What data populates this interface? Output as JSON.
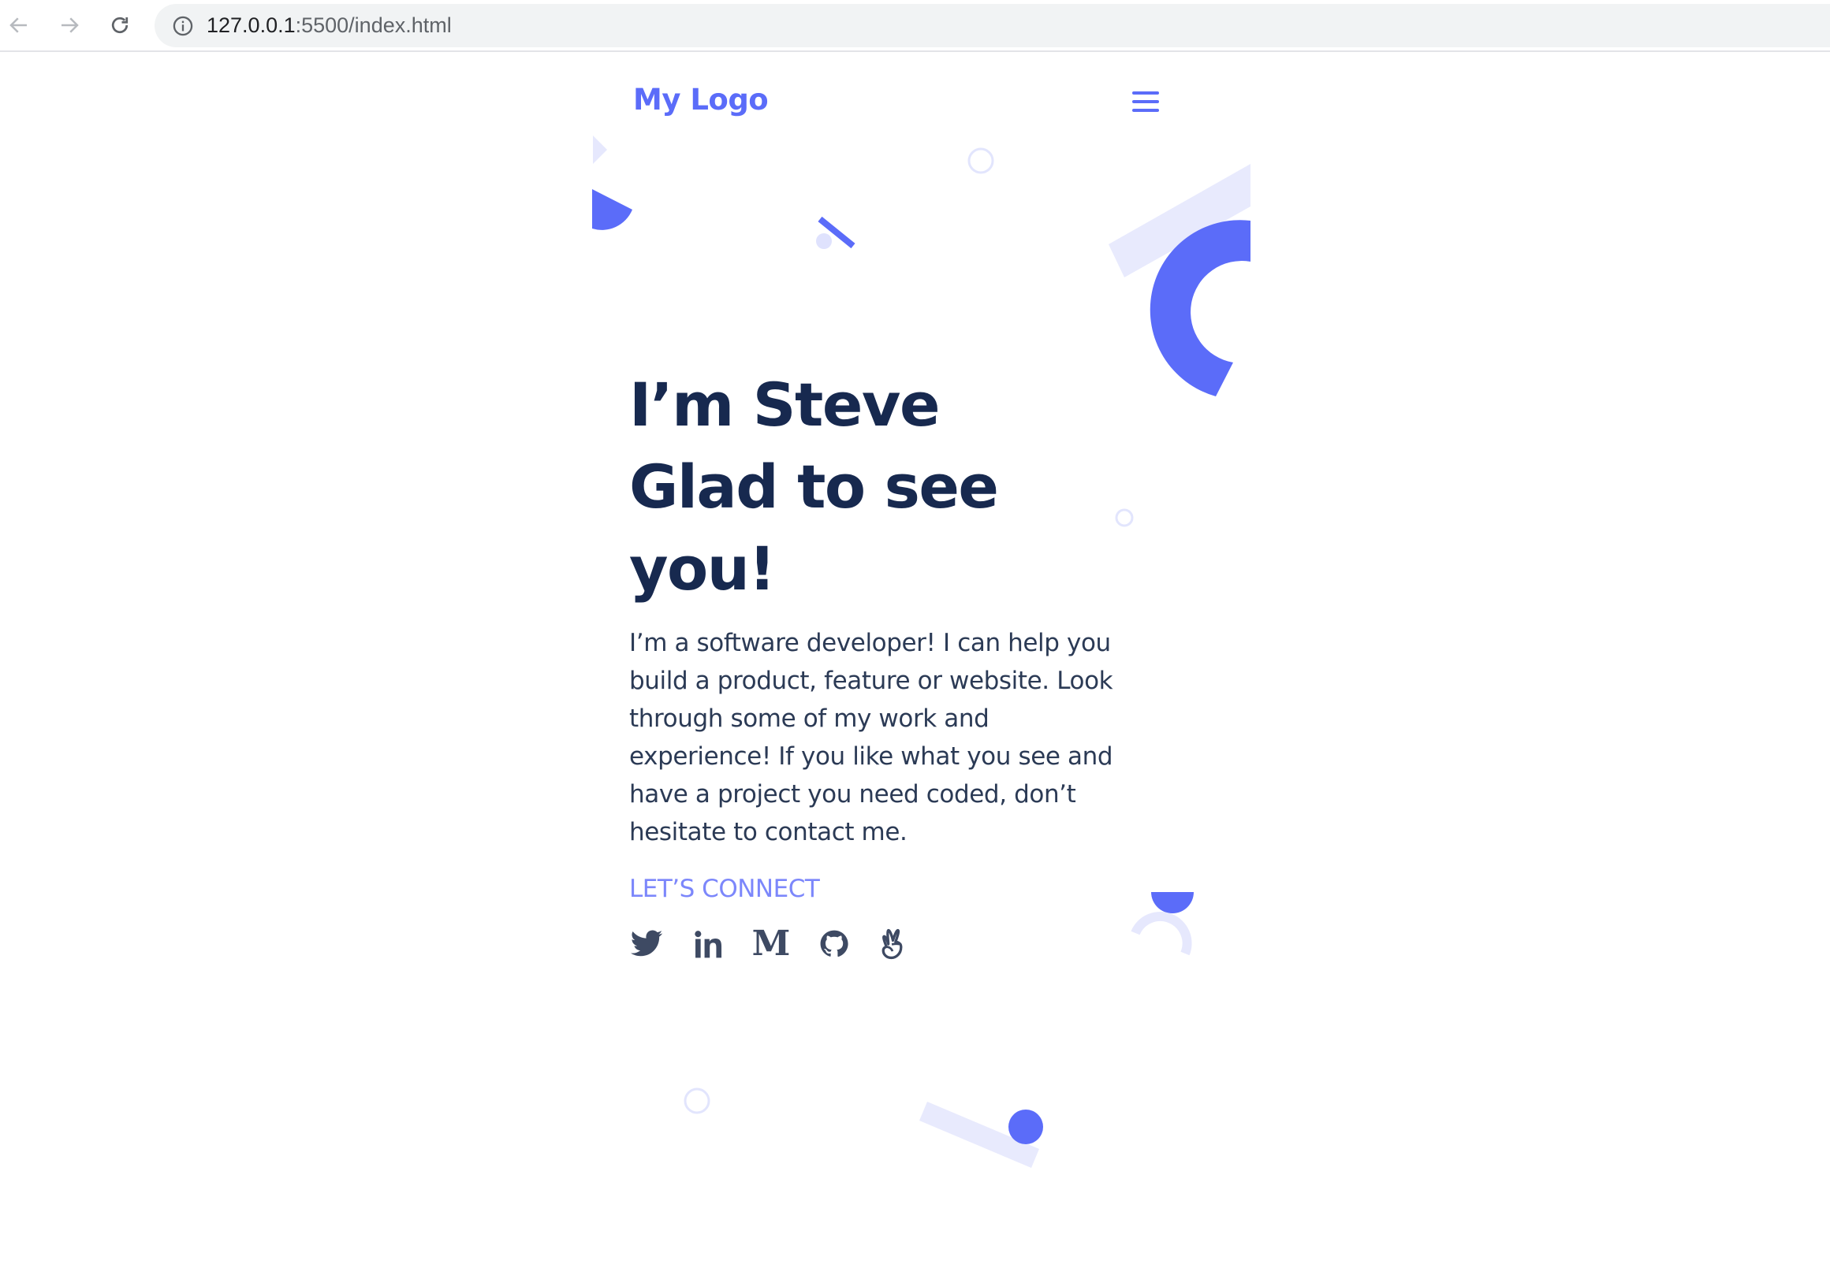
{
  "browser": {
    "url_host": "127.0.0.1",
    "url_rest": ":5500/index.html"
  },
  "header": {
    "logo": "My Logo",
    "menu_icon": "hamburger-menu-icon"
  },
  "hero": {
    "title_lines": [
      "I’m Steve",
      "Glad to see",
      "you!"
    ],
    "description_lines": [
      "I’m a software developer! I can help you",
      "build a product, feature or website. Look",
      "through some of my work and",
      "experience! If you like what you see and",
      "have a project you need coded, don’t",
      "hesitate to contact me."
    ],
    "connect_label": "LET’S CONNECT",
    "social_m": "M"
  },
  "social_icons": [
    "twitter-icon",
    "linkedin-icon",
    "medium-icon",
    "github-icon",
    "angellist-icon"
  ],
  "colors": {
    "accent": "#5b6cf9",
    "accent_light": "#e6e8fd",
    "heading": "#17294f",
    "body_text": "#2b3a55",
    "icon": "#3e4a63"
  }
}
